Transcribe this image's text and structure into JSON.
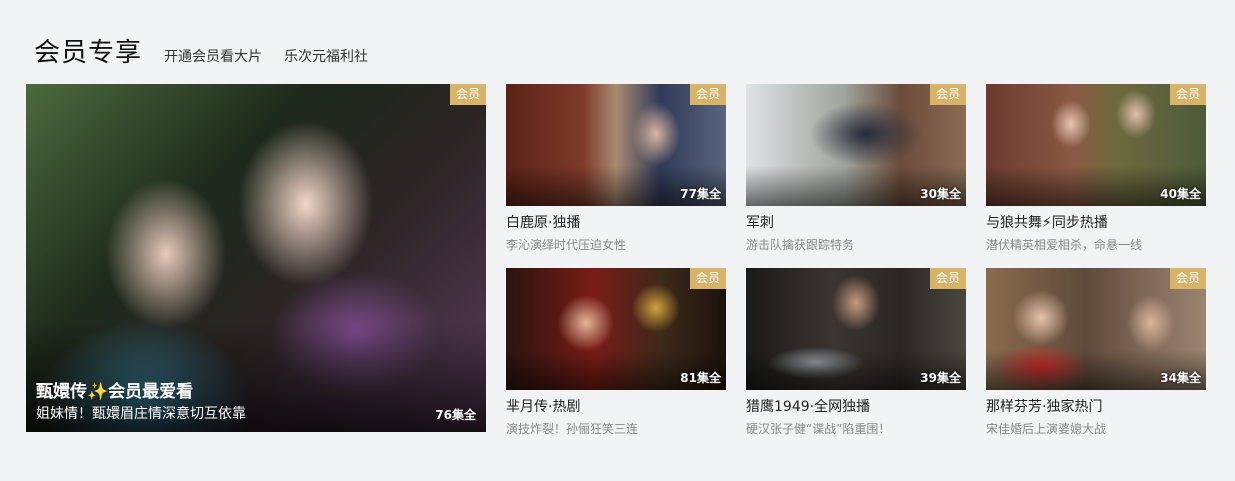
{
  "header": {
    "title": "会员专享",
    "links": [
      "开通会员看大片",
      "乐次元福利社"
    ]
  },
  "featured": {
    "badge": "会员",
    "title": "甄嬛传✨会员最爱看",
    "subtitle": "姐妹情！甄嬛眉庄情深意切互依靠",
    "episodes": "76集全"
  },
  "items": [
    {
      "badge": "会员",
      "episodes": "77集全",
      "title": "白鹿原·独播",
      "desc": "李沁演绎时代压迫女性"
    },
    {
      "badge": "会员",
      "episodes": "30集全",
      "title": "军刺",
      "desc": "游击队擒获跟踪特务"
    },
    {
      "badge": "会员",
      "episodes": "40集全",
      "title": "与狼共舞⚡同步热播",
      "desc": "潜伏精英相爱相杀，命悬一线"
    },
    {
      "badge": "会员",
      "episodes": "81集全",
      "title": "芈月传·热剧",
      "desc": "演技炸裂！孙俪狂笑三连"
    },
    {
      "badge": "会员",
      "episodes": "39集全",
      "title": "猎鹰1949·全网独播",
      "desc": "硬汉张子健“谍战”陷重围！"
    },
    {
      "badge": "会员",
      "episodes": "34集全",
      "title": "那样芬芳·独家热门",
      "desc": "宋佳婚后上演婆媳大战"
    }
  ],
  "colors": {
    "badge_bg": "#d8b36a",
    "page_bg": "#f2f3f5"
  }
}
